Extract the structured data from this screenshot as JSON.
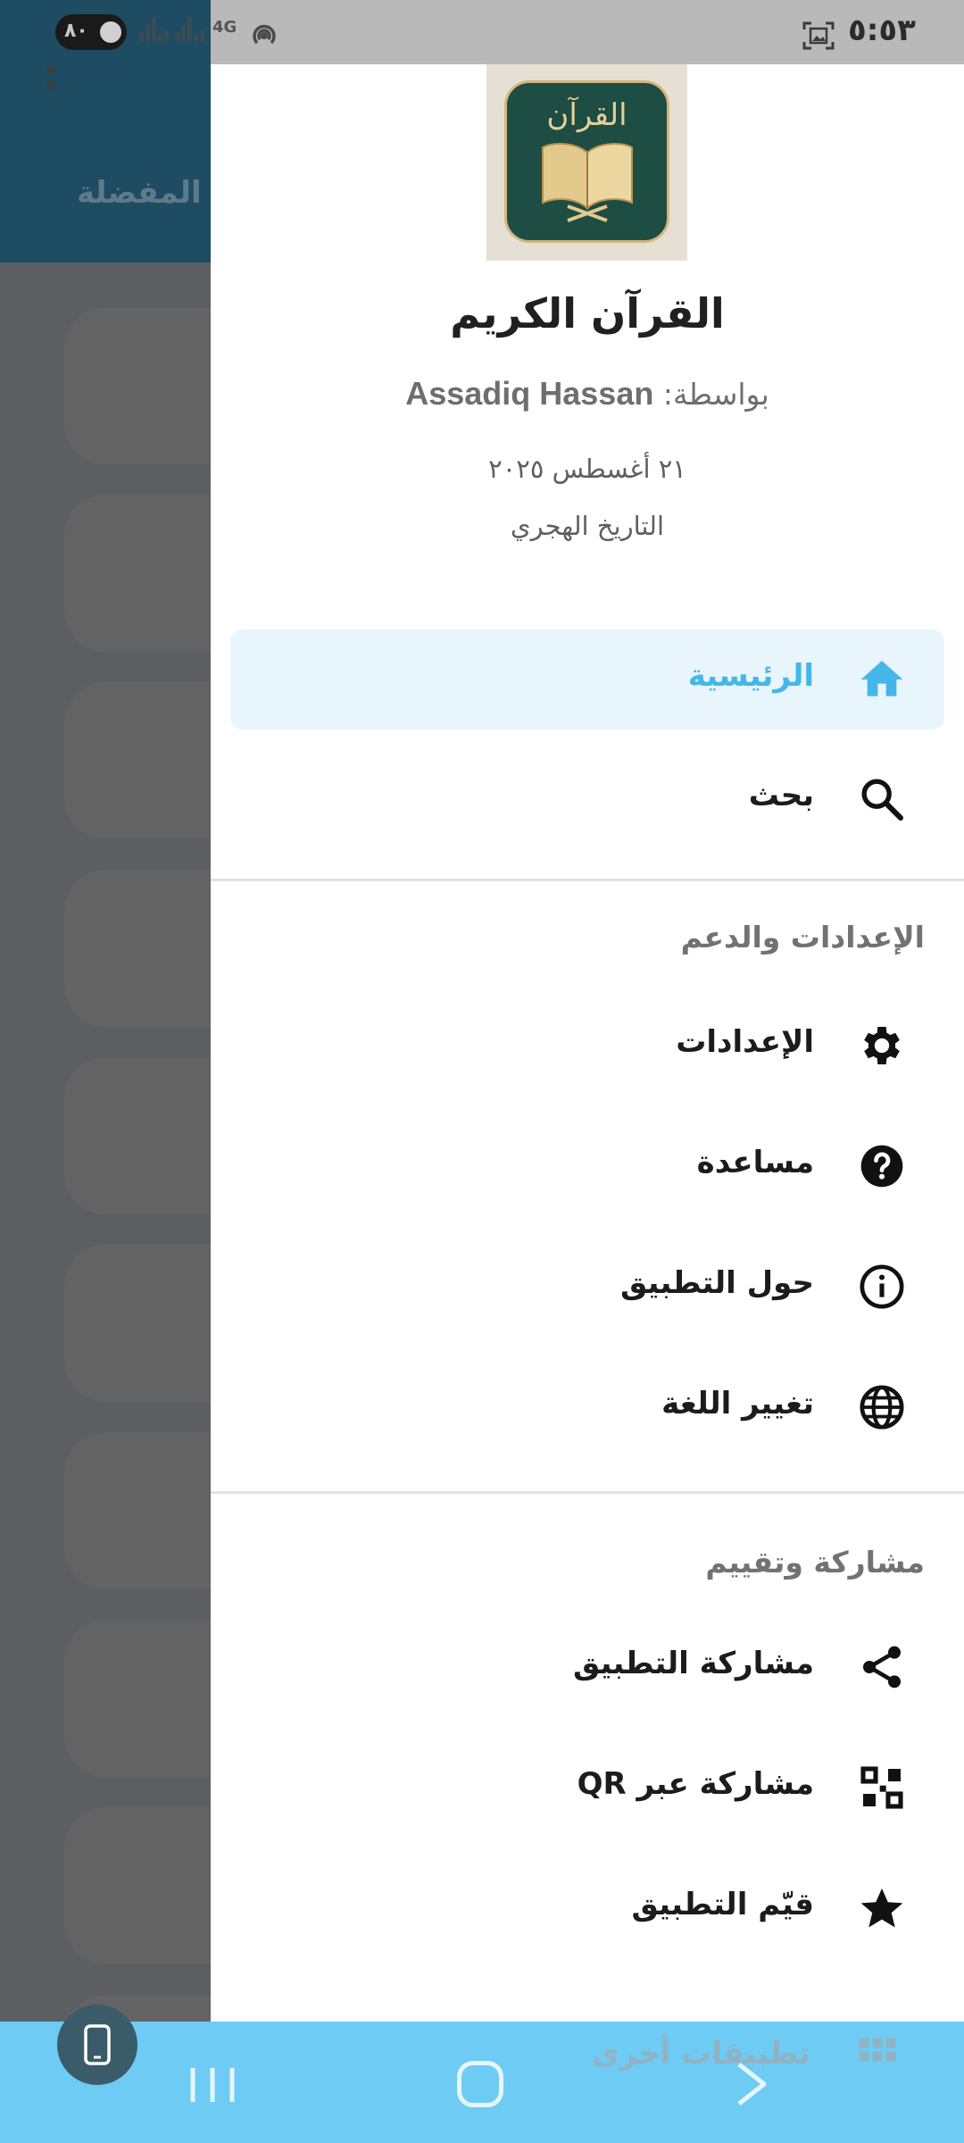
{
  "status_bar": {
    "battery": "٨٠",
    "network": "4G",
    "time": "٥:٥٣"
  },
  "background": {
    "tab_label": "المفضلة"
  },
  "drawer": {
    "header": {
      "app_name": "القرآن الكريم",
      "author_prefix": "بواسطة:",
      "author_name": "Assadiq Hassan",
      "gregorian_date": "٢١ أغسطس ٢٠٢٥",
      "hijri_date": "التاريخ الهجري",
      "icon_text": "القرآن"
    },
    "nav": [
      {
        "label": "الرئيسية",
        "icon": "home-icon",
        "active": true
      },
      {
        "label": "بحث",
        "icon": "search-icon",
        "active": false
      }
    ],
    "sections": [
      {
        "title": "الإعدادات والدعم",
        "items": [
          {
            "label": "الإعدادات",
            "icon": "gear-icon"
          },
          {
            "label": "مساعدة",
            "icon": "help-icon"
          },
          {
            "label": "حول التطبيق",
            "icon": "info-icon"
          },
          {
            "label": "تغيير اللغة",
            "icon": "globe-icon"
          }
        ]
      },
      {
        "title": "مشاركة وتقييم",
        "items": [
          {
            "label": "مشاركة التطبيق",
            "icon": "share-icon"
          },
          {
            "label": "مشاركة عبر QR",
            "icon": "qr-icon"
          },
          {
            "label": "قيّم التطبيق",
            "icon": "star-icon"
          },
          {
            "label": "تطبيقات أخرى",
            "icon": "apps-grid-icon"
          }
        ]
      }
    ]
  },
  "colors": {
    "accent": "#44b7e8",
    "active_bg": "#e8f5fc",
    "header_bg": "#1e4c62",
    "nav_bar": "#6ecbf3",
    "scrim": "#5c5f62"
  }
}
